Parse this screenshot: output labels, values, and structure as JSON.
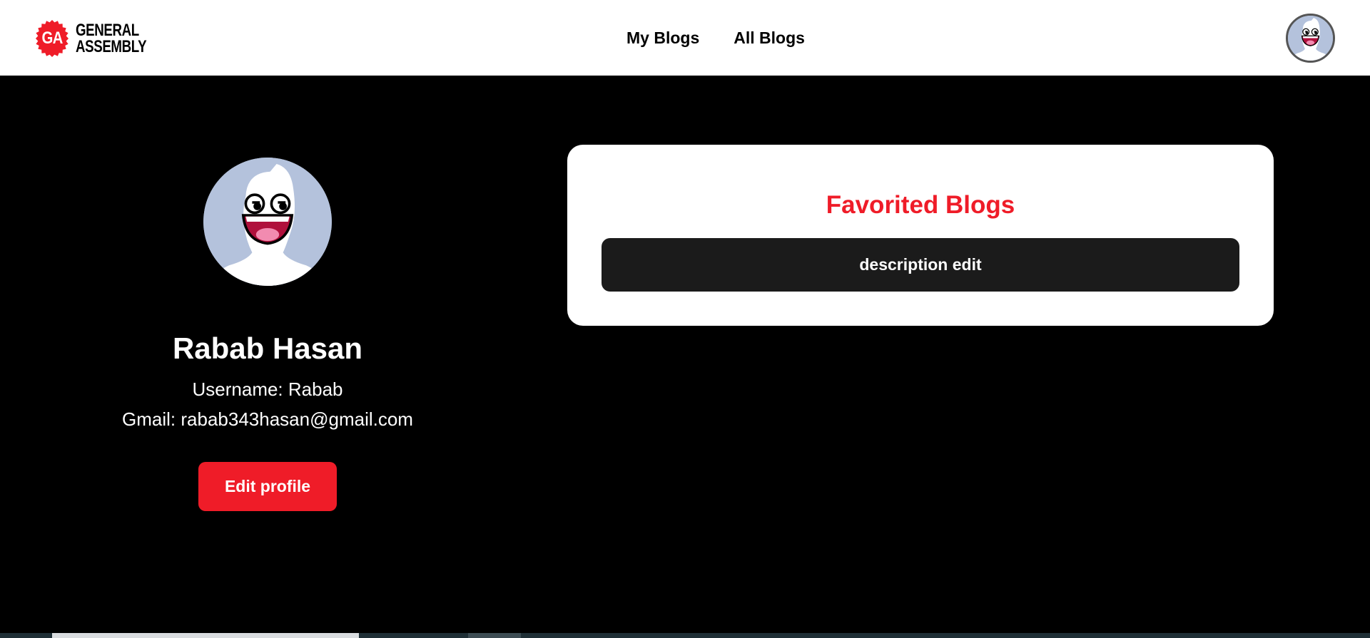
{
  "brand": {
    "badge": "GA",
    "line1": "GENERAL",
    "line2": "ASSEMBLY",
    "color": "#ef1c28"
  },
  "nav": {
    "links": [
      {
        "label": "My Blogs"
      },
      {
        "label": "All Blogs"
      }
    ],
    "avatar_icon": "user-avatar-icon"
  },
  "profile": {
    "name": "Rabab Hasan",
    "username": "Username: Rabab",
    "email": "Gmail: rabab343hasan@gmail.com",
    "edit_label": "Edit profile"
  },
  "favorites": {
    "title": "Favorited Blogs",
    "items": [
      {
        "label": "description edit"
      }
    ]
  },
  "colors": {
    "accent": "#ef1c28",
    "page_background": "#000000",
    "card_background": "#ffffff",
    "item_background": "#1b1b1b",
    "avatar_background": "#b4c2dc"
  }
}
